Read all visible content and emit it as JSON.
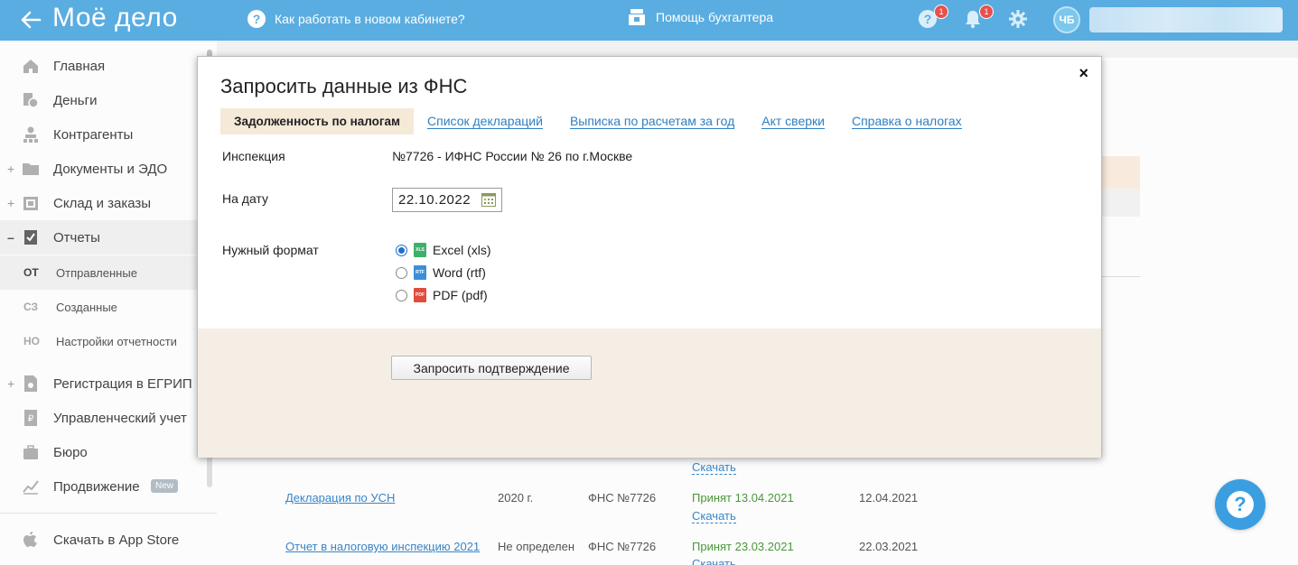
{
  "topbar": {
    "logo": "Моё дело",
    "help_link": "Как работать в новом кабинете?",
    "assistant": "Помощь бухгалтера",
    "help_badge": "1",
    "notifications_badge": "1",
    "avatar_initials": "ЧБ"
  },
  "sidebar": {
    "items": [
      {
        "label": "Главная",
        "icon": "home-icon"
      },
      {
        "label": "Деньги",
        "icon": "money-icon"
      },
      {
        "label": "Контрагенты",
        "icon": "contractors-icon"
      },
      {
        "label": "Документы и ЭДО",
        "icon": "folder-icon",
        "expand": "+"
      },
      {
        "label": "Склад и заказы",
        "icon": "warehouse-icon",
        "expand": "+"
      },
      {
        "label": "Отчеты",
        "icon": "reports-icon",
        "expand": "–"
      },
      {
        "label": "Регистрация в ЕГРИП",
        "icon": "registration-icon",
        "expand": "+"
      },
      {
        "label": "Управленческий учет",
        "icon": "management-icon"
      },
      {
        "label": "Бюро",
        "icon": "briefcase-icon"
      },
      {
        "label": "Продвижение",
        "icon": "chart-icon",
        "badge": "New"
      },
      {
        "label": "Скачать в App Store",
        "icon": "apple-icon"
      }
    ],
    "subitems": [
      {
        "abbr": "ОТ",
        "label": "Отправленные"
      },
      {
        "abbr": "СЗ",
        "label": "Созданные"
      },
      {
        "abbr": "НО",
        "label": "Настройки отчетности"
      }
    ]
  },
  "background_table": {
    "rows": [
      {
        "name": "",
        "period": "",
        "inspection": "",
        "status": "",
        "date": "",
        "download": "Скачать"
      },
      {
        "name": "Декларация по УСН",
        "period": "2020 г.",
        "inspection": "ФНС №7726",
        "status": "Принят 13.04.2021",
        "date": "12.04.2021",
        "download": "Скачать"
      },
      {
        "name": "Отчет в налоговую инспекцию 2021",
        "period": "Не определен",
        "inspection": "ФНС №7726",
        "status": "Принят 23.03.2021",
        "date": "22.03.2021",
        "download": "Скачать"
      }
    ]
  },
  "modal": {
    "title": "Запросить данные из ФНС",
    "close": "×",
    "tabs": [
      {
        "label": "Задолженность по налогам",
        "active": true
      },
      {
        "label": "Список деклараций",
        "active": false
      },
      {
        "label": "Выписка по расчетам за год",
        "active": false
      },
      {
        "label": "Акт сверки",
        "active": false
      },
      {
        "label": "Справка о налогах",
        "active": false
      }
    ],
    "inspection_label": "Инспекция",
    "inspection_value": "№7726 - ИФНС России № 26 по г.Москве",
    "date_label": "На дату",
    "date_value": "22.10.2022",
    "format_label": "Нужный формат",
    "formats": [
      {
        "label": "Excel (xls)",
        "icon_text": "XLS",
        "color": "#3fb06a",
        "checked": true
      },
      {
        "label": "Word (rtf)",
        "icon_text": "RTF",
        "color": "#3a8fd9",
        "checked": false
      },
      {
        "label": "PDF (pdf)",
        "icon_text": "PDF",
        "color": "#e24c3c",
        "checked": false
      }
    ],
    "submit_button": "Запросить подтверждение"
  },
  "colors": {
    "topbar": "#5aade0",
    "accent": "#3b9ee0",
    "active_tab": "#f5e9d8",
    "footer": "#f5eee4"
  }
}
